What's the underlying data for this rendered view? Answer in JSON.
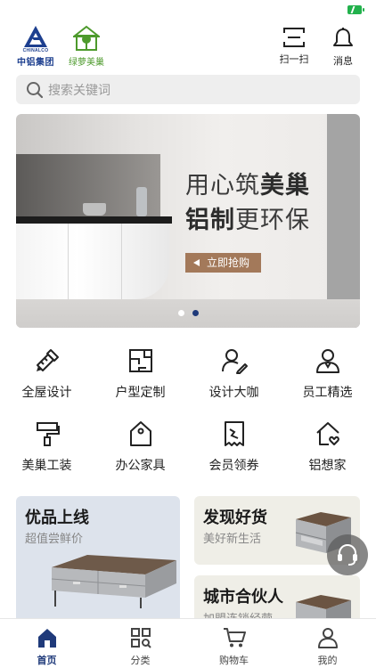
{
  "colors": {
    "brand": "#1f3a7a",
    "bronze": "#a3795a",
    "green": "#4d9a2c"
  },
  "header": {
    "logo_chinalco_en": "CHINALCO",
    "logo_chinalco_cn": "中铝集团",
    "logo_lvluo_cn": "绿萝美巢",
    "scan_label": "扫一扫",
    "message_label": "消息"
  },
  "search": {
    "placeholder": "搜索关键词"
  },
  "banner": {
    "headline1_a": "用心筑",
    "headline1_b": "美巢",
    "headline2_a": "铝制",
    "headline2_b": "更环保",
    "button": "立即抢购",
    "slides_total": 2,
    "active_slide": 2
  },
  "menu": [
    {
      "label": "全屋设计",
      "icon": "ruler-pencil-icon"
    },
    {
      "label": "户型定制",
      "icon": "floorplan-icon"
    },
    {
      "label": "设计大咖",
      "icon": "designer-icon"
    },
    {
      "label": "员工精选",
      "icon": "staff-icon"
    },
    {
      "label": "美巢工装",
      "icon": "roller-brush-icon"
    },
    {
      "label": "办公家具",
      "icon": "price-tag-icon"
    },
    {
      "label": "会员领券",
      "icon": "coupon-icon"
    },
    {
      "label": "铝想家",
      "icon": "house-heart-icon"
    }
  ],
  "cards": [
    {
      "title": "优品上线",
      "subtitle": "超值尝鲜价"
    },
    {
      "title": "发现好货",
      "subtitle": "美好新生活"
    },
    {
      "title": "城市合伙人",
      "subtitle": "加盟连锁经营"
    }
  ],
  "tabbar": [
    {
      "label": "首页",
      "icon": "home-icon",
      "active": true
    },
    {
      "label": "分类",
      "icon": "category-icon",
      "active": false
    },
    {
      "label": "购物车",
      "icon": "cart-icon",
      "active": false
    },
    {
      "label": "我的",
      "icon": "user-icon",
      "active": false
    }
  ]
}
